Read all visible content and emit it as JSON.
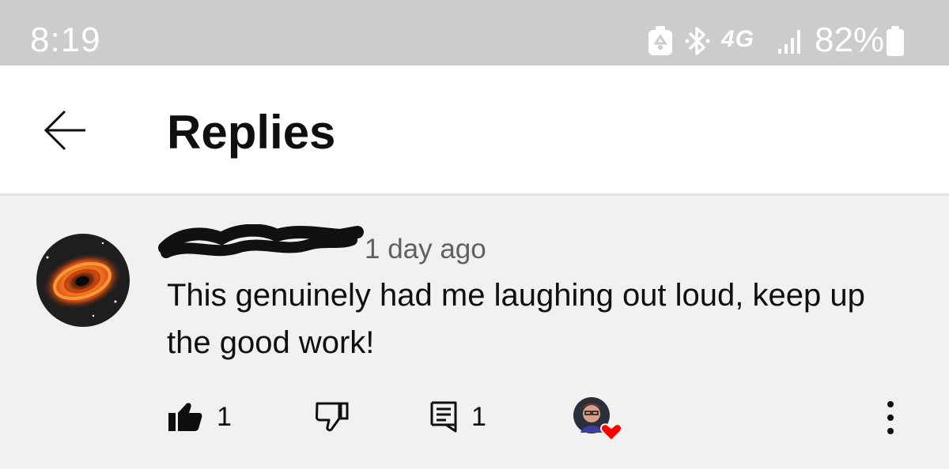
{
  "status_bar": {
    "time": "8:19",
    "network": "4G",
    "battery": "82%",
    "icons": [
      "recycle-icon",
      "bluetooth-icon",
      "signal-icon",
      "battery-icon"
    ]
  },
  "header": {
    "title": "Replies",
    "back_icon": "back-arrow-icon"
  },
  "comment": {
    "timestamp": "1 day ago",
    "text": "This genuinely had me laughing out loud, keep up the good work!",
    "likes": "1",
    "replies": "1",
    "icons": [
      "like-icon",
      "dislike-icon",
      "reply-icon",
      "creator-heart-icon",
      "more-vert-icon"
    ]
  },
  "colors": {
    "status_bar_bg": "#cccccc",
    "header_bg": "#ffffff",
    "comment_bg": "#f1f1f1",
    "heart": "#ff0000"
  }
}
